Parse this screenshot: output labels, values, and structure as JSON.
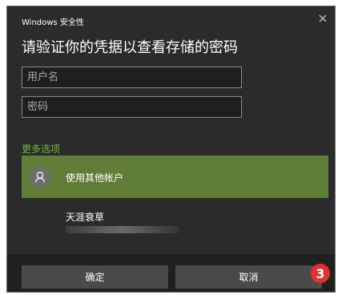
{
  "window": {
    "title": "Windows 安全性",
    "close_icon": "close-icon"
  },
  "heading": "请验证你的凭据以查看存储的密码",
  "fields": {
    "username_placeholder": "用户名",
    "password_placeholder": "密码"
  },
  "more_options": {
    "label": "更多选项",
    "other_account_label": "使用其他帐户",
    "other_account_icon": "user-icon",
    "account_name": "天涯衰草"
  },
  "buttons": {
    "ok_label": "确定",
    "cancel_label": "取消"
  },
  "annotation": {
    "step_number": "3",
    "color": "#e3302f"
  },
  "colors": {
    "accent": "#617e38",
    "link": "#78b53a",
    "dialog_bg": "#2b2b2b"
  }
}
